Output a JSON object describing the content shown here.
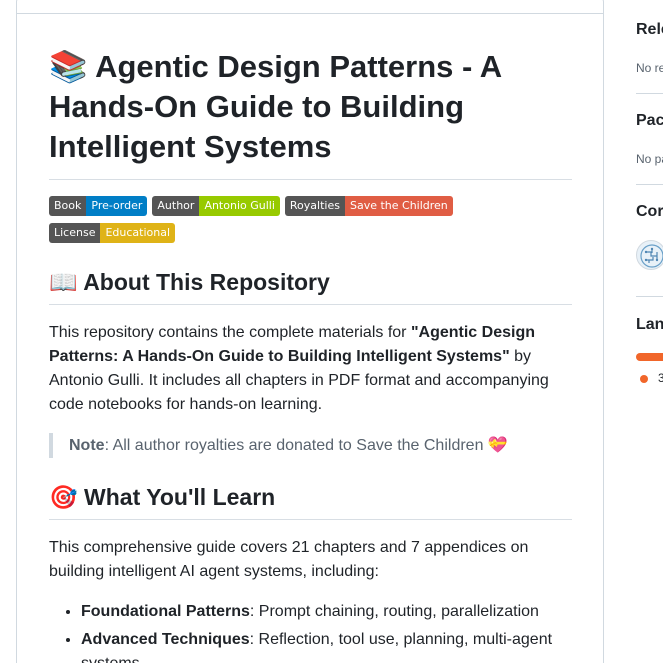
{
  "readme": {
    "title_emoji": "📚",
    "title": "Agentic Design Patterns - A Hands-On Guide to Building Intelligent Systems",
    "badges": [
      {
        "label": "Book",
        "value": "Pre-order",
        "color": "#007ec6"
      },
      {
        "label": "Author",
        "value": "Antonio Gulli",
        "color": "#97ca00"
      },
      {
        "label": "Royalties",
        "value": "Save the Children",
        "color": "#e05d44"
      },
      {
        "label": "License",
        "value": "Educational",
        "color": "#dfb317"
      }
    ],
    "about": {
      "emoji": "📖",
      "heading": "About This Repository",
      "text_before": "This repository contains the complete materials for ",
      "book_title": "\"Agentic Design Patterns: A Hands-On Guide to Building Intelligent Systems\"",
      "text_after": " by Antonio Gulli. It includes all chapters in PDF format and accompanying code notebooks for hands-on learning.",
      "note_label": "Note",
      "note_text": ": All author royalties are donated to Save the Children ",
      "note_emoji": "💝"
    },
    "learn": {
      "emoji": "🎯",
      "heading": "What You'll Learn",
      "intro": "This comprehensive guide covers 21 chapters and 7 appendices on building intelligent AI agent systems, including:",
      "items": [
        {
          "bold": "Foundational Patterns",
          "text": ": Prompt chaining, routing, parallelization"
        },
        {
          "bold": "Advanced Techniques",
          "text": ": Reflection, tool use, planning, multi-agent systems"
        }
      ]
    }
  },
  "sidebar": {
    "releases_title": "Rele",
    "releases_empty": "No re",
    "packages_title": "Pac",
    "packages_empty": "No pa",
    "contributors_title": "Cor",
    "languages_title": "Lan",
    "language_percent": "3",
    "language_color": "#f1662a"
  }
}
